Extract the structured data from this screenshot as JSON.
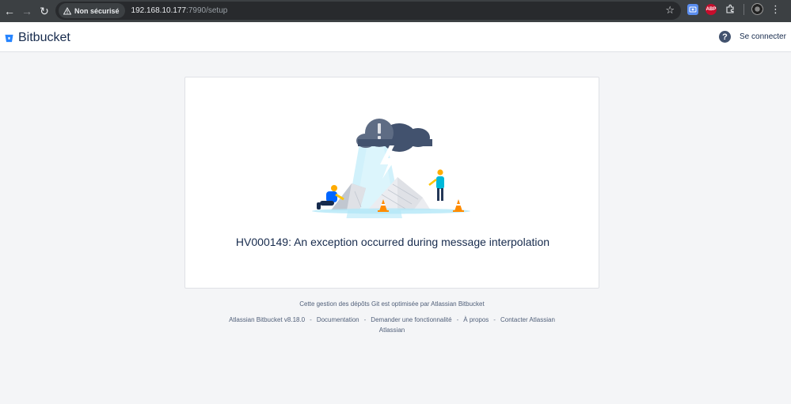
{
  "browser": {
    "security_label": "Non sécurisé",
    "url_host": "192.168.10.177",
    "url_rest": ":7990/setup",
    "extensions": {
      "abp_label": "ABP"
    }
  },
  "header": {
    "product_name": "Bitbucket",
    "login_label": "Se connecter"
  },
  "error": {
    "message": "HV000149: An exception occurred during message interpolation"
  },
  "footer": {
    "tagline": "Cette gestion des dépôts Git est optimisée par Atlassian Bitbucket",
    "links": [
      "Atlassian Bitbucket v8.18.0",
      "Documentation",
      "Demander une fonctionnalité",
      "À propos",
      "Contacter Atlassian"
    ],
    "separator": "-",
    "brand": "Atlassian"
  },
  "colors": {
    "brand_blue": "#2684ff",
    "chrome_bg": "#3c4043",
    "page_bg": "#f4f5f7"
  },
  "icons": {
    "back": "arrow-left-icon",
    "forward": "arrow-right-icon",
    "reload": "reload-icon",
    "warning": "warning-icon",
    "star": "star-icon",
    "help": "question-icon"
  }
}
